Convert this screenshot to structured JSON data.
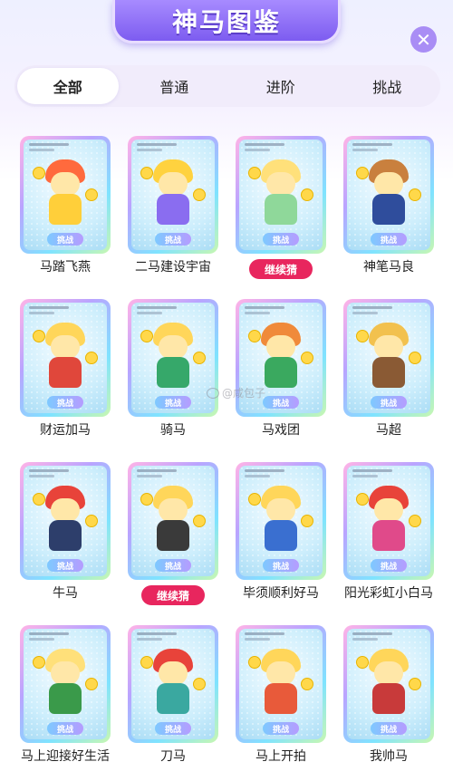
{
  "header": {
    "title": "神马图鉴"
  },
  "tabs": [
    {
      "label": "全部",
      "active": true
    },
    {
      "label": "普通",
      "active": false
    },
    {
      "label": "进阶",
      "active": false
    },
    {
      "label": "挑战",
      "active": false
    }
  ],
  "tier_badge_label": "挑战",
  "continue_label": "继续猜",
  "watermark": "咸包子",
  "cards": [
    {
      "name": "马踏飞燕",
      "status": "name"
    },
    {
      "name": "二马建设宇宙",
      "status": "name"
    },
    {
      "name": "继续猜",
      "status": "continue"
    },
    {
      "name": "神笔马良",
      "status": "name"
    },
    {
      "name": "财运加马",
      "status": "name"
    },
    {
      "name": "骑马",
      "status": "name"
    },
    {
      "name": "马戏团",
      "status": "name"
    },
    {
      "name": "马超",
      "status": "name"
    },
    {
      "name": "牛马",
      "status": "name"
    },
    {
      "name": "继续猜",
      "status": "continue"
    },
    {
      "name": "毕须顺利好马",
      "status": "name"
    },
    {
      "name": "阳光彩虹小白马",
      "status": "name"
    },
    {
      "name": "马上迎接好生活",
      "status": "name"
    },
    {
      "name": "刀马",
      "status": "name"
    },
    {
      "name": "马上开拍",
      "status": "name"
    },
    {
      "name": "我帅马",
      "status": "name"
    }
  ],
  "colors": {
    "accent": "#7d5cf0",
    "continue_button": "#e8265e",
    "tab_bar": "#f1ecfb"
  }
}
